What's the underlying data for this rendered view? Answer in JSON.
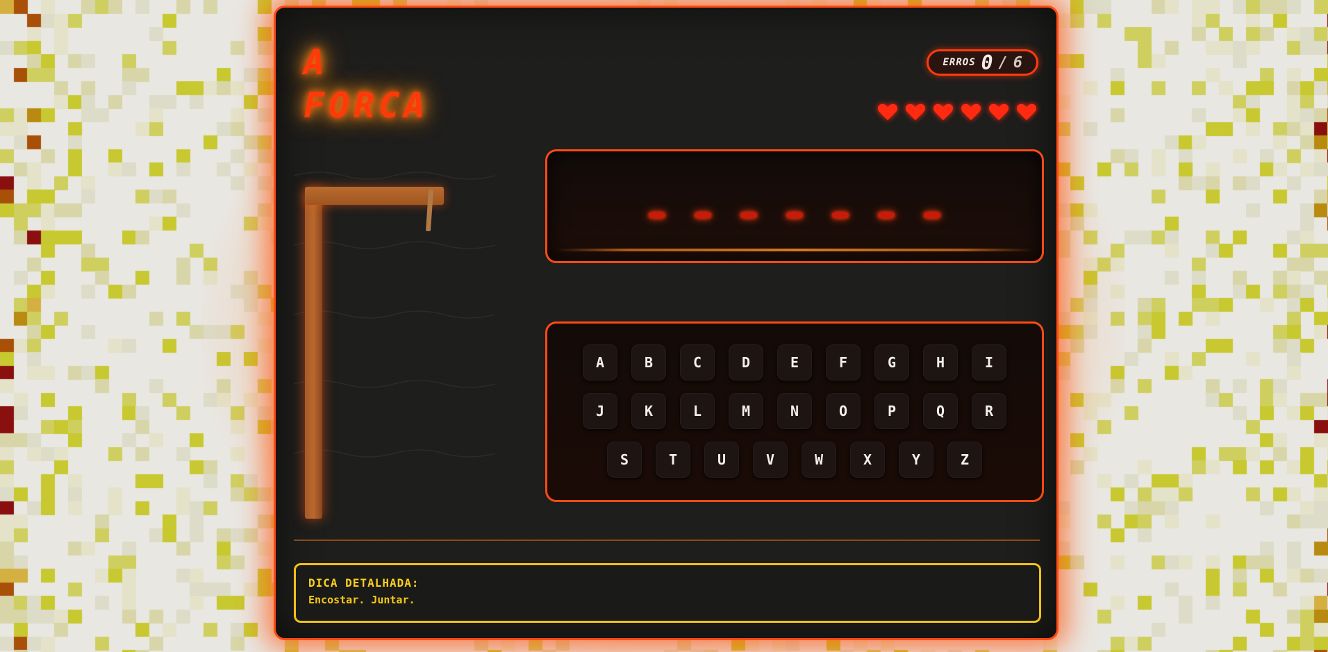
{
  "title": {
    "line1": "A",
    "line2": "FORCA"
  },
  "errors": {
    "label": "ERROS",
    "count": "0",
    "separator": "/",
    "max": "6"
  },
  "lives": {
    "remaining": 6,
    "total": 6,
    "icon": "heart-icon",
    "color": "#ff2a10"
  },
  "word": {
    "length": 7,
    "revealed": [
      "",
      "",
      "",
      "",
      "",
      "",
      ""
    ]
  },
  "keyboard": {
    "rows": [
      [
        "A",
        "B",
        "C",
        "D",
        "E",
        "F",
        "G",
        "H",
        "I"
      ],
      [
        "J",
        "K",
        "L",
        "M",
        "N",
        "O",
        "P",
        "Q",
        "R"
      ],
      [
        "S",
        "T",
        "U",
        "V",
        "W",
        "X",
        "Y",
        "Z"
      ]
    ]
  },
  "hint": {
    "title": "DICA DETALHADA:",
    "text": "Encostar. Juntar."
  },
  "colors": {
    "accent": "#ff4a14",
    "title": "#ff3a08",
    "hint": "#ffd020",
    "gallows_wood": "#a85a28"
  }
}
